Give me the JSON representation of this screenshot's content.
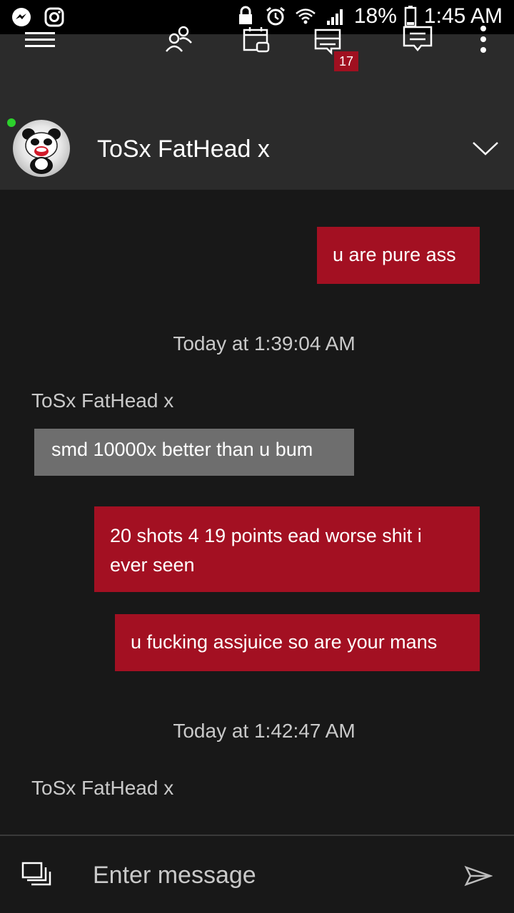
{
  "status_bar": {
    "battery_percent": "18%",
    "time": "1:45 AM"
  },
  "nav": {
    "messages_badge": "17",
    "icons": [
      "menu-icon",
      "friends-icon",
      "events-icon",
      "messages-icon",
      "activity-feed-icon",
      "more-options-icon"
    ]
  },
  "conversation": {
    "name": "ToSx FatHead x",
    "presence": "online"
  },
  "messages": [
    {
      "type": "out",
      "text": "u are pure ass"
    },
    {
      "type": "timestamp",
      "text": "Today at 1:39:04 AM"
    },
    {
      "type": "sender",
      "text": "ToSx FatHead x"
    },
    {
      "type": "in",
      "text": "smd 10000x better than u bum"
    },
    {
      "type": "out",
      "text": "20 shots 4 19 points ead worse shit i ever seen"
    },
    {
      "type": "out",
      "text": "u fucking assjuice so are your mans"
    },
    {
      "type": "timestamp",
      "text": "Today at 1:42:47 AM"
    },
    {
      "type": "sender",
      "text": "ToSx FatHead x"
    }
  ],
  "compose": {
    "placeholder": "Enter message"
  },
  "colors": {
    "background": "#181818",
    "header": "#2b2b2b",
    "outgoing_bubble": "#a31022",
    "incoming_bubble": "#6e6e6e",
    "presence_online": "#2cd12c"
  }
}
